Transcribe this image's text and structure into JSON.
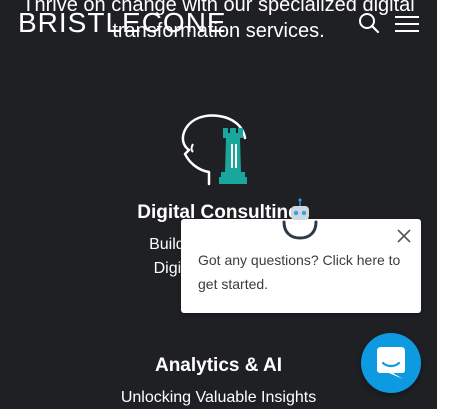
{
  "hero": {
    "line1": "Thrive on change with our specialized digital",
    "line2": "transformation services."
  },
  "header": {
    "logo_text": "BRISTLECONE",
    "search_icon": "search-icon",
    "menu_icon": "hamburger-menu-icon"
  },
  "services": [
    {
      "icon": "head-chess-rook-icon",
      "title": "Digital Consulting",
      "desc_line1": "Building Connected",
      "desc_line2": "Digital Enterprises"
    },
    {
      "title": "Analytics & AI",
      "desc_line1": "Unlocking Valuable Insights"
    }
  ],
  "chat": {
    "popup_text": "Got any questions? Click here to get started.",
    "close_icon": "close-icon",
    "bot_icon": "robot-avatar-icon",
    "launcher_icon": "chat-bubble-icon",
    "brand_color": "#0d9ae0"
  },
  "colors": {
    "background": "#1f2024",
    "accent_teal": "#19a69c",
    "text": "#ffffff"
  }
}
